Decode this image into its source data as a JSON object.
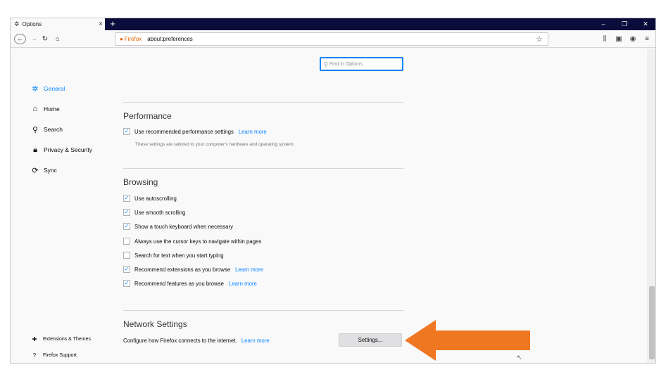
{
  "browser": {
    "tab": {
      "title": "Options",
      "icon": "gear-icon"
    },
    "new_tab": "+",
    "window_controls": {
      "minimize": "–",
      "restore": "❐",
      "close": "✕"
    },
    "url": {
      "brand": "Firefox",
      "address": "about:preferences"
    }
  },
  "find": {
    "placeholder": "Find in Options"
  },
  "nav": {
    "items": [
      {
        "label": "General",
        "icon": "gear-icon",
        "active": true
      },
      {
        "label": "Home",
        "icon": "home-icon"
      },
      {
        "label": "Search",
        "icon": "search-icon"
      },
      {
        "label": "Privacy & Security",
        "icon": "lock-icon"
      },
      {
        "label": "Sync",
        "icon": "sync-icon"
      }
    ],
    "extensions": "Extensions & Themes",
    "support": "Firefox Support"
  },
  "performance": {
    "title": "Performance",
    "recommended": {
      "label": "Use recommended performance settings",
      "checked": true,
      "link": "Learn more"
    },
    "hint": "These settings are tailored to your computer's hardware and operating system."
  },
  "browsing": {
    "title": "Browsing",
    "options": [
      {
        "label": "Use autoscrolling",
        "checked": true
      },
      {
        "label": "Use smooth scrolling",
        "checked": true
      },
      {
        "label": "Show a touch keyboard when necessary",
        "checked": true
      },
      {
        "label": "Always use the cursor keys to navigate within pages",
        "checked": false
      },
      {
        "label": "Search for text when you start typing",
        "checked": false
      },
      {
        "label": "Recommend extensions as you browse",
        "checked": true,
        "link": "Learn more"
      },
      {
        "label": "Recommend features as you browse",
        "checked": true,
        "link": "Learn more"
      }
    ]
  },
  "network": {
    "title": "Network Settings",
    "description": "Configure how Firefox connects to the internet.",
    "link": "Learn more",
    "button": "Settings..."
  },
  "colors": {
    "accent": "#0a84ff",
    "arrow": "#f07722",
    "tabstrip": "#0c0c3c"
  }
}
